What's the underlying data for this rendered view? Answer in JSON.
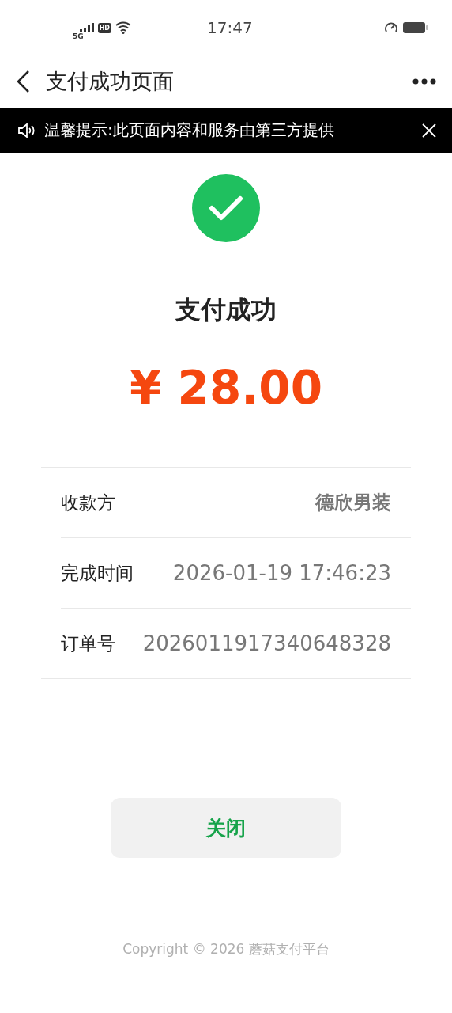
{
  "status_bar": {
    "network": "5G",
    "hd": "HD",
    "time": "17:47"
  },
  "nav": {
    "title": "支付成功页面"
  },
  "notice": {
    "text": "温馨提示:此页面内容和服务由第三方提供"
  },
  "result": {
    "title": "支付成功",
    "amount": "¥ 28.00"
  },
  "details": [
    {
      "label": "收款方",
      "value": "德欣男装",
      "bold": true
    },
    {
      "label": "完成时间",
      "value": "2026-01-19 17:46:23",
      "bold": false
    },
    {
      "label": "订单号",
      "value": "2026011917340648328",
      "bold": false
    }
  ],
  "close_button": "关闭",
  "footer": "Copyright © 2026 蘑菇支付平台"
}
